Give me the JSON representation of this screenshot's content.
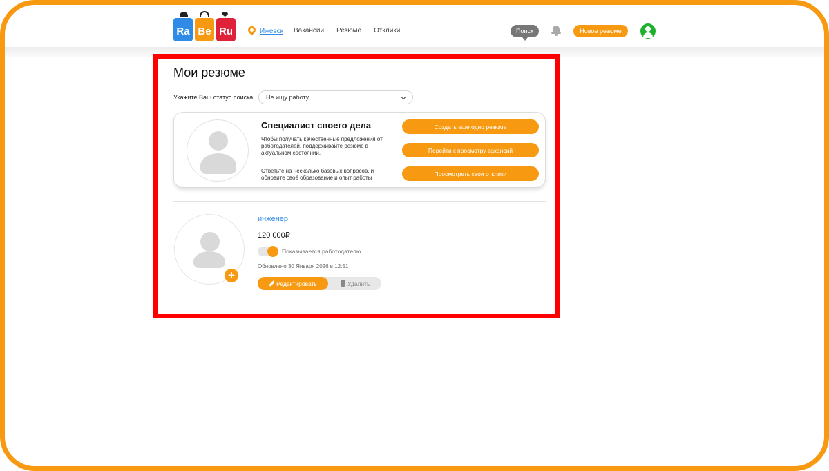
{
  "header": {
    "logo": [
      "Ra",
      "Be",
      "Ru"
    ],
    "city": "Ижевск",
    "nav": [
      "Вакансии",
      "Резюме",
      "Отклики"
    ],
    "search_label": "Поиск",
    "new_resume_label": "Новое резюме"
  },
  "main": {
    "title": "Мои резюме",
    "status_label": "Укажите Ваш статус поиска",
    "status_value": "Не ищу работу",
    "promo": {
      "title": "Специалист своего дела",
      "text1": "Чтобы получать качественные предложения от работодателей, поддерживайте резюме в актуальном состоянии.",
      "text2": "Ответьте на несколько базовых вопросов, и обновите своё образование и опыт работы",
      "buttons": [
        "Создать еще одно резюме",
        "Перейти к просмотру вакансий",
        "Просмотреть свои отклики"
      ]
    },
    "resume": {
      "title": "инженер",
      "salary": "120 000₽",
      "visibility_label": "Показывается работодателю",
      "visible": true,
      "updated": "Обновлено 30 Января 2026 в 12:51",
      "edit_label": "Редактировать",
      "delete_label": "Удалить"
    }
  },
  "colors": {
    "accent": "#f79a12",
    "link": "#2f8be6",
    "highlight": "#ff0000",
    "user": "#1fb02e"
  }
}
